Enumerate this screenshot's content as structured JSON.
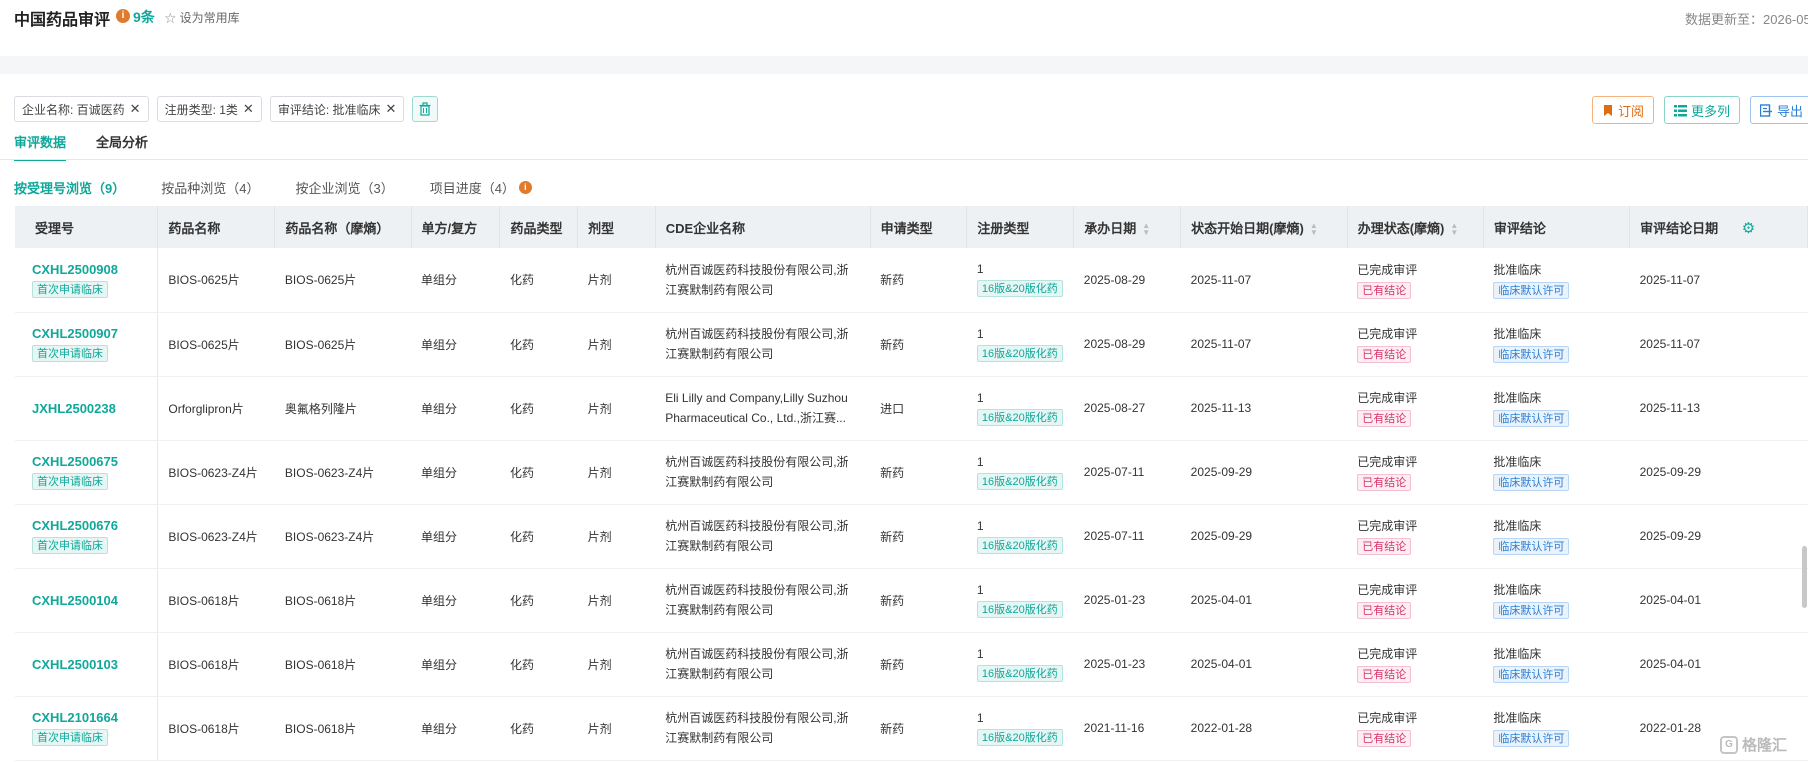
{
  "header": {
    "title": "中国药品审评",
    "info_glyph": "i",
    "count": "9条",
    "fav_label": "设为常用库",
    "update_text": "数据更新至：2026-05"
  },
  "filters": [
    {
      "label": "企业名称: 百诚医药"
    },
    {
      "label": "注册类型: 1类"
    },
    {
      "label": "审评结论: 批准临床"
    }
  ],
  "actions": {
    "subscribe": "订阅",
    "more_cols": "更多列",
    "export": "导出"
  },
  "tabs": [
    "审评数据",
    "全局分析"
  ],
  "subtabs": [
    "按受理号浏览（9）",
    "按品种浏览（4）",
    "按企业浏览（3）",
    "项目进度（4）"
  ],
  "columns": [
    "受理号",
    "药品名称",
    "药品名称（摩熵）",
    "单方/复方",
    "药品类型",
    "剂型",
    "CDE企业名称",
    "申请类型",
    "注册类型",
    "承办日期",
    "状态开始日期(摩熵)",
    "办理状态(摩熵)",
    "审评结论",
    "审评结论日期"
  ],
  "rows": [
    {
      "id": "CXHL2500908",
      "tag": "首次申请临床",
      "name": "BIOS-0625片",
      "name2": "BIOS-0625片",
      "combo": "单组分",
      "dtype": "化药",
      "form": "片剂",
      "company": "杭州百诚医药科技股份有限公司,浙江赛默制药有限公司",
      "app": "新药",
      "reg": "1",
      "reg_tag": "16版&20版化药",
      "accept": "2025-08-29",
      "status_start": "2025-11-07",
      "status": "已完成审评",
      "status_tag": "已有结论",
      "conclusion": "批准临床",
      "conc_tag": "临床默认许可",
      "conc_date": "2025-11-07"
    },
    {
      "id": "CXHL2500907",
      "tag": "首次申请临床",
      "name": "BIOS-0625片",
      "name2": "BIOS-0625片",
      "combo": "单组分",
      "dtype": "化药",
      "form": "片剂",
      "company": "杭州百诚医药科技股份有限公司,浙江赛默制药有限公司",
      "app": "新药",
      "reg": "1",
      "reg_tag": "16版&20版化药",
      "accept": "2025-08-29",
      "status_start": "2025-11-07",
      "status": "已完成审评",
      "status_tag": "已有结论",
      "conclusion": "批准临床",
      "conc_tag": "临床默认许可",
      "conc_date": "2025-11-07"
    },
    {
      "id": "JXHL2500238",
      "tag": "",
      "name": "Orforglipron片",
      "name2": "奥氟格列隆片",
      "combo": "单组分",
      "dtype": "化药",
      "form": "片剂",
      "company": "Eli Lilly and Company,Lilly Suzhou Pharmaceutical Co., Ltd.,浙江赛...",
      "app": "进口",
      "reg": "1",
      "reg_tag": "16版&20版化药",
      "accept": "2025-08-27",
      "status_start": "2025-11-13",
      "status": "已完成审评",
      "status_tag": "已有结论",
      "conclusion": "批准临床",
      "conc_tag": "临床默认许可",
      "conc_date": "2025-11-13"
    },
    {
      "id": "CXHL2500675",
      "tag": "首次申请临床",
      "name": "BIOS-0623-Z4片",
      "name2": "BIOS-0623-Z4片",
      "combo": "单组分",
      "dtype": "化药",
      "form": "片剂",
      "company": "杭州百诚医药科技股份有限公司,浙江赛默制药有限公司",
      "app": "新药",
      "reg": "1",
      "reg_tag": "16版&20版化药",
      "accept": "2025-07-11",
      "status_start": "2025-09-29",
      "status": "已完成审评",
      "status_tag": "已有结论",
      "conclusion": "批准临床",
      "conc_tag": "临床默认许可",
      "conc_date": "2025-09-29"
    },
    {
      "id": "CXHL2500676",
      "tag": "首次申请临床",
      "name": "BIOS-0623-Z4片",
      "name2": "BIOS-0623-Z4片",
      "combo": "单组分",
      "dtype": "化药",
      "form": "片剂",
      "company": "杭州百诚医药科技股份有限公司,浙江赛默制药有限公司",
      "app": "新药",
      "reg": "1",
      "reg_tag": "16版&20版化药",
      "accept": "2025-07-11",
      "status_start": "2025-09-29",
      "status": "已完成审评",
      "status_tag": "已有结论",
      "conclusion": "批准临床",
      "conc_tag": "临床默认许可",
      "conc_date": "2025-09-29"
    },
    {
      "id": "CXHL2500104",
      "tag": "",
      "name": "BIOS-0618片",
      "name2": "BIOS-0618片",
      "combo": "单组分",
      "dtype": "化药",
      "form": "片剂",
      "company": "杭州百诚医药科技股份有限公司,浙江赛默制药有限公司",
      "app": "新药",
      "reg": "1",
      "reg_tag": "16版&20版化药",
      "accept": "2025-01-23",
      "status_start": "2025-04-01",
      "status": "已完成审评",
      "status_tag": "已有结论",
      "conclusion": "批准临床",
      "conc_tag": "临床默认许可",
      "conc_date": "2025-04-01"
    },
    {
      "id": "CXHL2500103",
      "tag": "",
      "name": "BIOS-0618片",
      "name2": "BIOS-0618片",
      "combo": "单组分",
      "dtype": "化药",
      "form": "片剂",
      "company": "杭州百诚医药科技股份有限公司,浙江赛默制药有限公司",
      "app": "新药",
      "reg": "1",
      "reg_tag": "16版&20版化药",
      "accept": "2025-01-23",
      "status_start": "2025-04-01",
      "status": "已完成审评",
      "status_tag": "已有结论",
      "conclusion": "批准临床",
      "conc_tag": "临床默认许可",
      "conc_date": "2025-04-01"
    },
    {
      "id": "CXHL2101664",
      "tag": "首次申请临床",
      "name": "BIOS-0618片",
      "name2": "BIOS-0618片",
      "combo": "单组分",
      "dtype": "化药",
      "form": "片剂",
      "company": "杭州百诚医药科技股份有限公司,浙江赛默制药有限公司",
      "app": "新药",
      "reg": "1",
      "reg_tag": "16版&20版化药",
      "accept": "2021-11-16",
      "status_start": "2022-01-28",
      "status": "已完成审评",
      "status_tag": "已有结论",
      "conclusion": "批准临床",
      "conc_tag": "临床默认许可",
      "conc_date": "2022-01-28"
    }
  ],
  "watermark": "格隆汇",
  "watermark_glyph": "G",
  "colors": {
    "accent": "#0fa89a",
    "orange": "#e06c12",
    "red": "#d6336c",
    "blue": "#2a7fd4"
  },
  "icons": {
    "star": "star-icon",
    "trash": "trash-icon",
    "gear": "gear-icon",
    "close": "close-icon"
  }
}
